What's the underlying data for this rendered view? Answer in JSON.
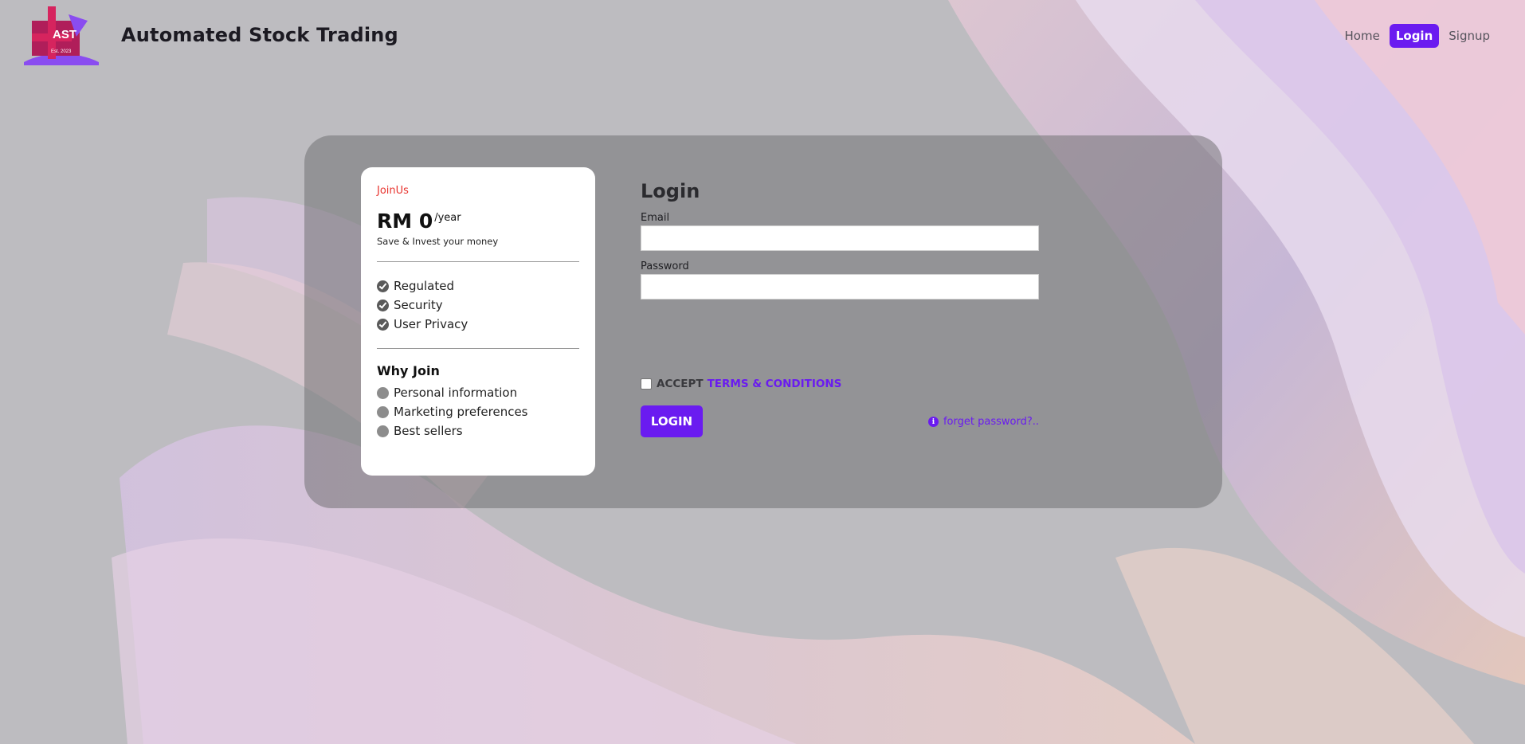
{
  "header": {
    "brand_title": "Automated Stock Trading",
    "logo": {
      "text": "AST",
      "subtext": "Est. 2023",
      "icon": "ast-logo"
    },
    "nav": [
      {
        "label": "Home",
        "active": false
      },
      {
        "label": "Login",
        "active": true
      },
      {
        "label": "Signup",
        "active": false
      }
    ]
  },
  "card": {
    "join_label": "JoinUs",
    "price_amount": "RM 0",
    "price_period": "/year",
    "price_sub": "Save & Invest your money",
    "features": [
      "Regulated",
      "Security",
      "User Privacy"
    ],
    "why_title": "Why Join",
    "reasons": [
      "Personal information",
      "Marketing preferences",
      "Best sellers"
    ]
  },
  "form": {
    "title": "Login",
    "email_label": "Email",
    "email_value": "",
    "password_label": "Password",
    "password_value": "",
    "accept_text": "ACCEPT",
    "terms_link": "TERMS & CONDITIONS",
    "login_button": "LOGIN",
    "forgot_link": "forget password?.."
  },
  "colors": {
    "accent": "#6a1bf0",
    "join_label": "#e8332e"
  }
}
